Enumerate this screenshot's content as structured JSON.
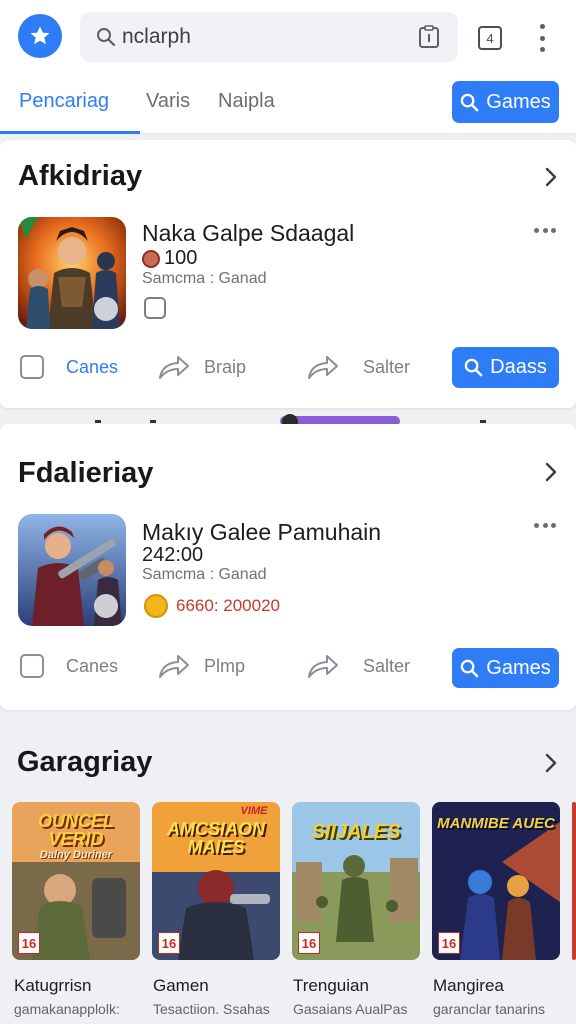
{
  "header": {
    "search": {
      "value": "nclarph",
      "placeholder": "nclarph"
    },
    "tab_count": "4",
    "nav_tabs": [
      {
        "label": "Pencariag",
        "active": true
      },
      {
        "label": "Varis",
        "active": false
      },
      {
        "label": "Naipla",
        "active": false
      }
    ],
    "games_button": "Games",
    "accent_color": "#2f7df6"
  },
  "section1": {
    "title": "Afkidriay",
    "app": {
      "name": "Naka Galpe Sdaagal",
      "meta": "100",
      "sub": "Samcma : Ganad"
    },
    "actions": [
      {
        "label": "Canes",
        "icon": "checkbox-icon"
      },
      {
        "label": "Braip",
        "icon": "share-arrow-icon"
      },
      {
        "label": "Salter",
        "icon": "share-arrow-icon"
      }
    ],
    "button": "Daass"
  },
  "section2": {
    "title": "Fdalieriay",
    "app": {
      "name": "Makıy Galee Pamuhain",
      "meta": "242:00",
      "sub": "Samcma : Ganad",
      "price": "6660: 200020"
    },
    "actions": [
      {
        "label": "Canes",
        "icon": "checkbox-icon"
      },
      {
        "label": "Plmp",
        "icon": "share-arrow-icon"
      },
      {
        "label": "Salter",
        "icon": "share-arrow-icon"
      }
    ],
    "button": "Games"
  },
  "section3": {
    "title": "Garagriay",
    "tiles": [
      {
        "art_title": "OUNCEL VERID",
        "art_sub": "Dalny Duriner",
        "age": "16",
        "name": "Katugrrisn",
        "sub": "gamakanapplolk:"
      },
      {
        "art_title": "AMCSIAON MAIES",
        "art_sub": "VIME",
        "age": "16",
        "name": "Gamen",
        "sub": "Tesactiion. Ssahas"
      },
      {
        "art_title": "SIIJALES",
        "art_sub": "",
        "age": "16",
        "name": "Trenguian",
        "sub": "Gasaians AualPas"
      },
      {
        "art_title": "MANMIBE AUEC",
        "art_sub": "",
        "age": "16",
        "name": "Mangirea",
        "sub": "garanclar tanarins"
      }
    ]
  }
}
